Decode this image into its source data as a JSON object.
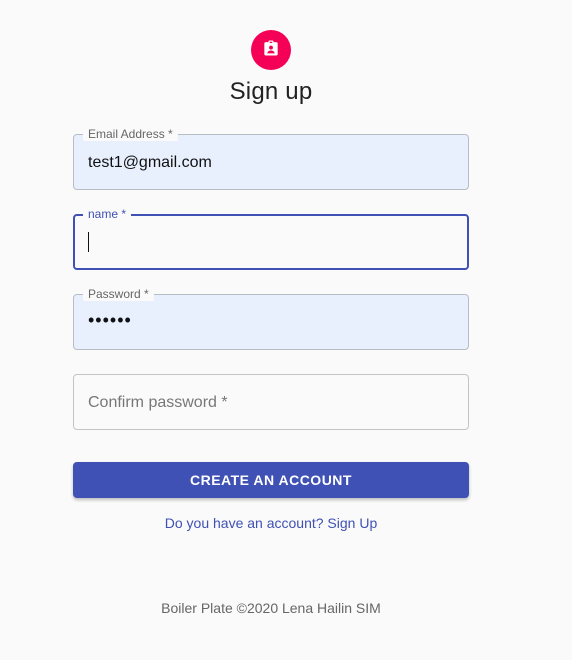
{
  "header": {
    "title": "Sign up",
    "avatar_icon": "contact-badge-icon",
    "avatar_color": "#f50057"
  },
  "form": {
    "email": {
      "label": "Email Address *",
      "value": "test1@gmail.com"
    },
    "name": {
      "label": "name *",
      "value": ""
    },
    "password": {
      "label": "Password *",
      "value": "••••••"
    },
    "confirm_password": {
      "placeholder": "Confirm password *"
    },
    "submit_label": "CREATE AN ACCOUNT",
    "alt_link": "Do you have an account? Sign Up"
  },
  "footer": {
    "text": "Boiler Plate ©2020 Lena Hailin SIM"
  },
  "colors": {
    "primary": "#3f51b5",
    "accent": "#f50057",
    "autofill_bg": "#e8f0fe"
  }
}
